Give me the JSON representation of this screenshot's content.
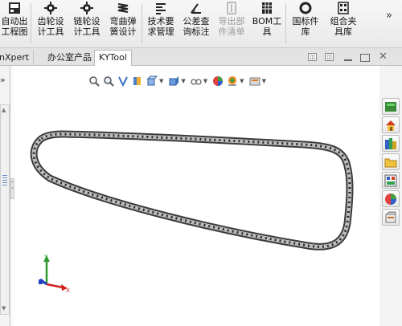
{
  "ribbon": {
    "buttons": [
      {
        "label": "自动出\n工程图",
        "icon": "auto-drawing-icon"
      },
      {
        "label": "齿轮设\n计工具",
        "icon": "gear-design-icon"
      },
      {
        "label": "链轮设\n计工具",
        "icon": "sprocket-design-icon"
      },
      {
        "label": "弯曲弹\n簧设计",
        "icon": "spring-design-icon"
      },
      {
        "label": "技术要\n求管理",
        "icon": "tech-requirements-icon"
      },
      {
        "label": "公差查\n询标注",
        "icon": "tolerance-icon"
      },
      {
        "label": "导出部\n件清单",
        "icon": "export-bom-icon",
        "disabled": true
      },
      {
        "label": "BOM工\n具",
        "icon": "bom-tool-icon"
      },
      {
        "label": "国标件\n库",
        "icon": "standard-parts-icon"
      },
      {
        "label": "组合夹\n具库",
        "icon": "fixture-library-icon"
      }
    ],
    "more": "»"
  },
  "tabs": [
    {
      "label": "nXpert"
    },
    {
      "label": "办公室产品"
    },
    {
      "label": "KYTool",
      "active": true
    }
  ],
  "left_panel": {
    "chevron": "»"
  },
  "task_pane": {
    "icons": [
      "resources-icon",
      "home-icon",
      "design-library-icon",
      "file-explorer-icon",
      "view-palette-icon",
      "appearances-icon",
      "custom-properties-icon"
    ]
  },
  "viewport": {
    "triad_labels": {
      "x": "X",
      "y": "Y",
      "z": "Z"
    },
    "model": "chain-loop"
  }
}
